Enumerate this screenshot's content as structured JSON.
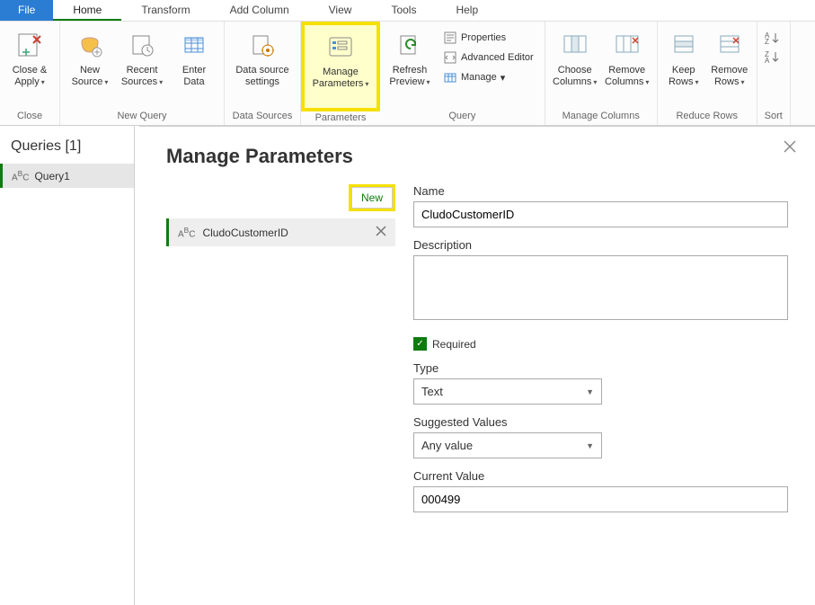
{
  "menu": {
    "file": "File",
    "home": "Home",
    "transform": "Transform",
    "add_column": "Add Column",
    "view": "View",
    "tools": "Tools",
    "help": "Help"
  },
  "ribbon": {
    "close_apply": "Close &\nApply",
    "close_group": "Close",
    "new_source": "New\nSource",
    "recent_sources": "Recent\nSources",
    "enter_data": "Enter\nData",
    "new_query_group": "New Query",
    "data_source_settings": "Data source\nsettings",
    "data_sources_group": "Data Sources",
    "manage_parameters": "Manage\nParameters",
    "parameters_group": "Parameters",
    "refresh_preview": "Refresh\nPreview",
    "properties": "Properties",
    "advanced_editor": "Advanced Editor",
    "manage": "Manage",
    "query_group": "Query",
    "choose_columns": "Choose\nColumns",
    "remove_columns": "Remove\nColumns",
    "manage_columns_group": "Manage Columns",
    "keep_rows": "Keep\nRows",
    "remove_rows": "Remove\nRows",
    "reduce_rows_group": "Reduce Rows",
    "sort_group": "Sort"
  },
  "queries": {
    "title": "Queries [1]",
    "item1": "Query1"
  },
  "dialog": {
    "title": "Manage Parameters",
    "new_btn": "New",
    "param_name": "CludoCustomerID",
    "name_label": "Name",
    "name_value": "CludoCustomerID",
    "description_label": "Description",
    "description_value": "",
    "required_label": "Required",
    "type_label": "Type",
    "type_value": "Text",
    "suggested_label": "Suggested Values",
    "suggested_value": "Any value",
    "current_label": "Current Value",
    "current_value": "000499"
  }
}
